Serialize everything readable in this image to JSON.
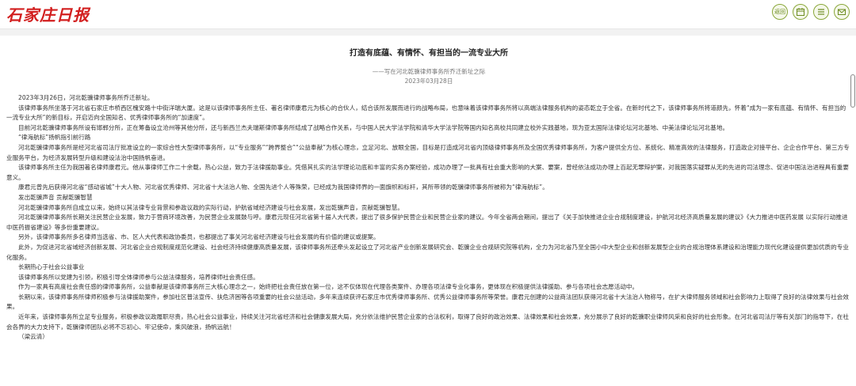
{
  "header": {
    "logo_text": "石家庄日报",
    "tools": [
      {
        "icon": "back-icon",
        "label": "返回"
      },
      {
        "icon": "calendar-icon"
      },
      {
        "icon": "menu-icon"
      },
      {
        "icon": "mail-icon"
      }
    ],
    "accent_color": "#8aa73a",
    "brand_color": "#d21f1f"
  },
  "article": {
    "title": "打造有底蕴、有情怀、有担当的一流专业大所",
    "subtitle": "——写在河北乾骥律师事务所乔迁新址之际",
    "date": "2023年03月28日",
    "paragraphs": [
      "2023年3月26日，河北乾骥律师事务所乔迁新址。",
      "该律师事务所坐落于河北省石家庄市桥西区槐安路十中街洋瑞大厦。这是以该律师事务所主任、著名律师康君元为核心的合伙人，结合该所发展而进行的战略布局，也意味着该律师事务所将以高端法律服务机构的姿态乾立于全省。在新时代之下，该律师事务所将道颜先，怀着“成为一家有底蕴、有情怀、有担当的一流专业大所”的新目标，开启迈向全国知名、优秀律师事务所的“加速度”。",
      "目前河北乾骥律师事务所设有邯郸分所，正在筹备设立沧州等其他分所，还与新西兰杰夫瑞斯律师事务所结成了战略合作关系，与中国人民大学法学院和清华大学法学院等国内知名高校共同建立校外实践基地，现为亚太国际法律论坛河北基地、中美法律论坛河北基地。",
      "“律海航标”扬帆指引前行路",
      "河北乾骥律师事务所是经河北省司法厅批准设立的一家综合性大型律师事务所，以“专业服务”“跨界整合”“公益奉献”为核心理念，立足河北、放眼全国，目标是打造成河北省内顶级律师事务所及全国优秀律师事务所，为客户提供全方位、系统化、精准高效的法律服务，打造政企对接平台、企企合作平台、第三方专业服务平台，为经济发展转型升级和建设法治中国扬帆奋进。",
      "该律师事务所主任为我国著名律师康君元。他从事律师工作二十余载，热心公益，致力于法律援助事业。凭借其扎实的法学理论功底和丰富的实务办案经验，成功办理了一批具有社会重大影响的大案、要案，曾经依法成功办理上百起无罪辩护案，对我国落实疑罪从无的先进的司法理念、促进中国法治进程具有重要意义。",
      "康君元曾先后获得河北省“感动省城”十大人物、河北省优秀律师、河北省十大法治人物、全国先进个人等殊荣，已经成为我国律师界的一面旗帜和标杆，其所带领的乾骥律师事务所被称为“律海航标”。",
      "发出乾骥声音 贡献乾骥智慧",
      "河北乾骥律师事务所自成立以来，始终以其法律专业背景和参政议政的实际行动，护航省域经济建设与社会发展，发出乾骥声音，贡献乾骥智慧。",
      "河北乾骥律师事务所长期关注民营企业发展，致力于营商环境改善，为民营企业发展鼓与呼。康君元现任河北省第十届人大代表，提出了很多保护民营企业和民营企业家的建议。今年全省两会期间，提出了《关于加快推进企业合规制度建设，护航河北经济高质量发展的建议》《大力推进中医药发展 以实际行动推进中医药振省建设》等多份重要建议。",
      "另外，该律师事务所多名律师当选省、市、区人大代表和政协委员，也都提出了事关河北省经济建设与社会发展的有价值的建议或提案。",
      "此外，为促进河北省域经济创新发展、河北省企业合规制度规范化建设、社会经济持续健康高质量发展，该律师事务所还牵头发起设立了河北省产业创新发展研究会、乾骥企业合规研究院等机构，全力为河北省乃至全国小中大型企业和创新发展型企业的合规治理体系建设和治理能力现代化建设提供更加优质的专业化服务。",
      "长期热心于社会公益事业",
      "该律师事务所以党建为引领，积极引导全体律师参与公益法律服务，培养律师社会责任感。",
      "作为一家具有高度社会责任感的律师事务所，公益奉献是该律师事务所三大核心理念之一，始终把社会责任放在第一位，这不仅体现在代理各类案件、办理各项法律专业化事务，更体现在积极提供法律援助、参与各项社会志愿活动中。",
      "长期以来，该律师事务所律师积极参与法律援助案件，参加社区普法宣传、扶危济困等各项重要的社会公益活动，多年来连续获评石家庄市优秀律师事务所、优秀公益律师事务所等荣誉。康君元创建的公益商法团队获得河北省十大法治人物称号，在扩大律师服务领域和社会影响力上取得了良好的法律效果与社会效果。",
      "近年来，该律师事务所立足专业服务，积极参政议政履职尽责，热心社会公益事业，持续关注河北省经济和社会健康发展大局，充分依法维护民营企业家的合法权利，取得了良好的政治效果、法律效果和社会效果，充分展示了良好的乾骥职业律师风采和良好的社会形象。在河北省司法厅等有关部门的指导下，在社会各界的大力支持下，乾骥律师团队必将不忘初心、牢记使命，乘风破浪，扬帆远航！",
      "（梁云清）"
    ]
  }
}
